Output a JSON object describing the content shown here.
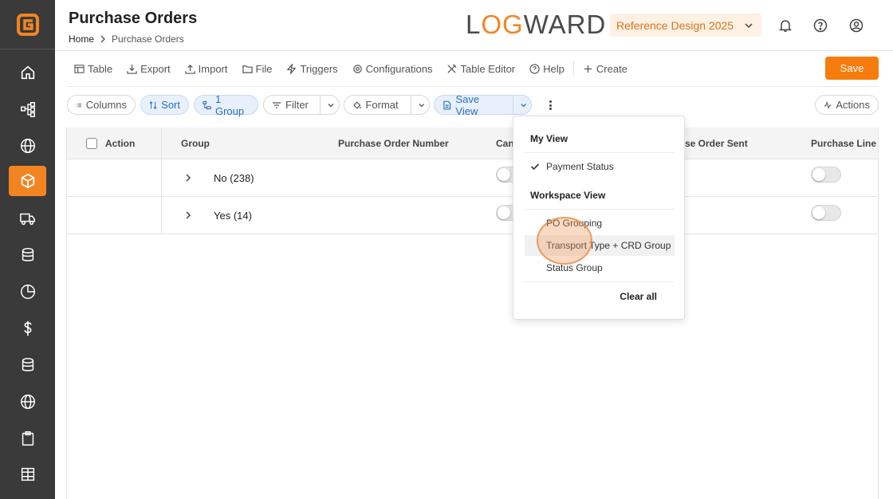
{
  "header": {
    "title": "Purchase Orders",
    "breadcrumb": [
      "Home",
      "Purchase Orders"
    ],
    "brand": {
      "part1": "L",
      "part2": "O",
      "part3": "G",
      "part4": "WARD"
    },
    "workspace_select": "Reference Design 2025"
  },
  "toolbar": {
    "items": [
      "Table",
      "Export",
      "Import",
      "File",
      "Triggers",
      "Configurations",
      "Table Editor",
      "Help",
      "Create"
    ],
    "save_label": "Save"
  },
  "filters": {
    "columns": "Columns",
    "sort": "Sort",
    "group": "1 Group",
    "filter": "Filter",
    "format": "Format",
    "save_view": "Save View",
    "actions": "Actions"
  },
  "table": {
    "headers": [
      "Action",
      "Group",
      "Purchase Order Number",
      "Can",
      "se Order Sent",
      "Purchase Line C"
    ],
    "rows": [
      {
        "label": "No (238)"
      },
      {
        "label": "Yes (14)"
      }
    ]
  },
  "view_menu": {
    "my_view_heading": "My View",
    "my_view_items": [
      "Payment Status"
    ],
    "workspace_heading": "Workspace View",
    "workspace_items": [
      "PO Grouping",
      "Transport Type + CRD Group",
      "Status Group"
    ],
    "clear_all": "Clear all"
  },
  "colors": {
    "accent": "#f28522",
    "sidebar": "#3a3a3a",
    "save_button": "#f57c0c",
    "pill_blue": "#2f6fbf"
  }
}
